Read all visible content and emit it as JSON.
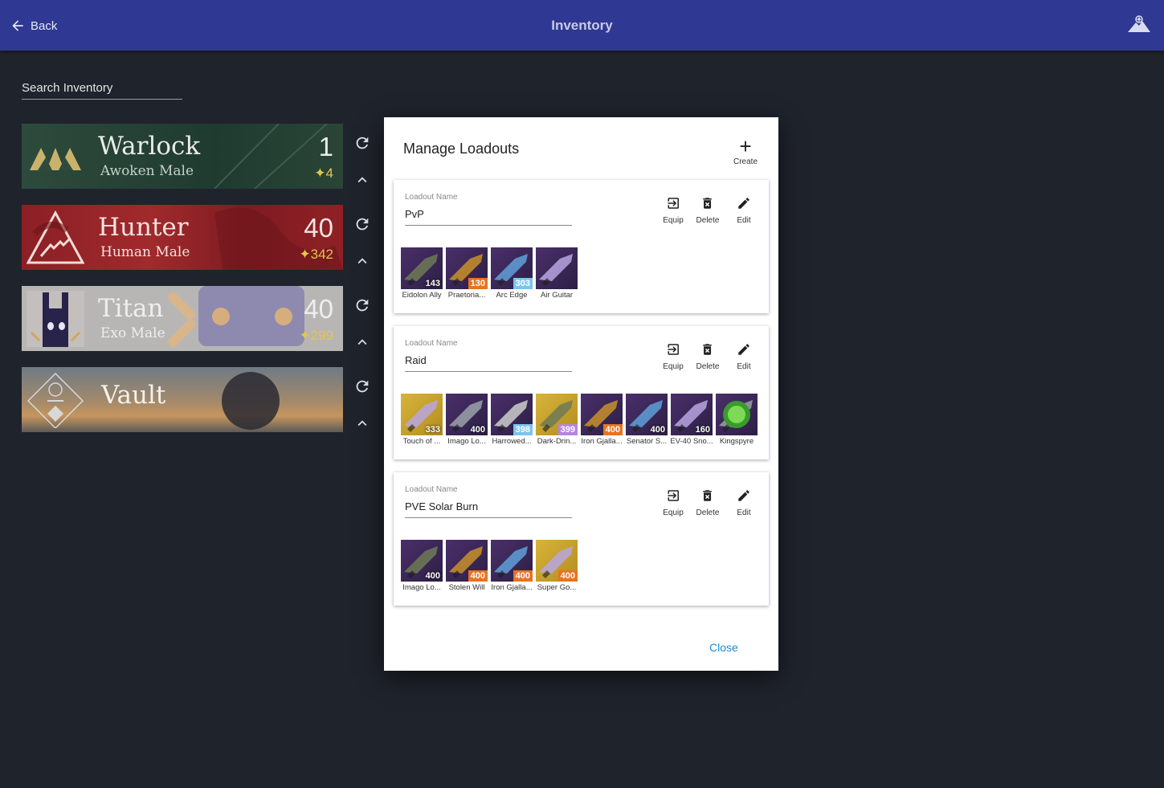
{
  "header": {
    "back_label": "Back",
    "title": "Inventory"
  },
  "search": {
    "placeholder": "Search Inventory"
  },
  "characters": [
    {
      "name": "Warlock",
      "subtitle": "Awoken Male",
      "level": "1",
      "light": "✦4"
    },
    {
      "name": "Hunter",
      "subtitle": "Human Male",
      "level": "40",
      "light": "✦342"
    },
    {
      "name": "Titan",
      "subtitle": "Exo Male",
      "level": "40",
      "light": "✦299"
    },
    {
      "name": "Vault"
    }
  ],
  "dialog": {
    "title": "Manage Loadouts",
    "create_label": "Create",
    "close_label": "Close",
    "field_label": "Loadout Name",
    "actions": {
      "equip": "Equip",
      "delete": "Delete",
      "edit": "Edit"
    },
    "loadouts": [
      {
        "name": "PvP",
        "items": [
          {
            "name": "Eidolon Ally",
            "power": "143",
            "element": "kinetic"
          },
          {
            "name": "Praetoria...",
            "power": "130",
            "element": "solar"
          },
          {
            "name": "Arc Edge",
            "power": "303",
            "element": "arc"
          },
          {
            "name": "Air Guitar",
            "power": "",
            "element": "none"
          }
        ]
      },
      {
        "name": "Raid",
        "items": [
          {
            "name": "Touch of ...",
            "power": "333",
            "element": "kinetic"
          },
          {
            "name": "Imago Lo...",
            "power": "400",
            "element": "kinetic"
          },
          {
            "name": "Harrowed...",
            "power": "398",
            "element": "arc"
          },
          {
            "name": "Dark-Drin...",
            "power": "399",
            "element": "void"
          },
          {
            "name": "Iron Gjalla...",
            "power": "400",
            "element": "solar"
          },
          {
            "name": "Senator S...",
            "power": "400",
            "element": "kinetic"
          },
          {
            "name": "EV-40 Sno...",
            "power": "160",
            "element": "kinetic"
          },
          {
            "name": "Kingspyre",
            "power": "",
            "element": "none"
          }
        ]
      },
      {
        "name": "PVE Solar Burn",
        "items": [
          {
            "name": "Imago Lo...",
            "power": "400",
            "element": "kinetic"
          },
          {
            "name": "Stolen Will",
            "power": "400",
            "element": "solar"
          },
          {
            "name": "Iron Gjalla...",
            "power": "400",
            "element": "solar"
          },
          {
            "name": "Super Go...",
            "power": "400",
            "element": "solar"
          }
        ]
      }
    ]
  },
  "colors": {
    "topbar": "#2f3892",
    "background": "#1f232b",
    "accent": "#1e88d0",
    "solar": "#e9731f",
    "arc": "#7bc4ee",
    "void": "#b685e0"
  }
}
